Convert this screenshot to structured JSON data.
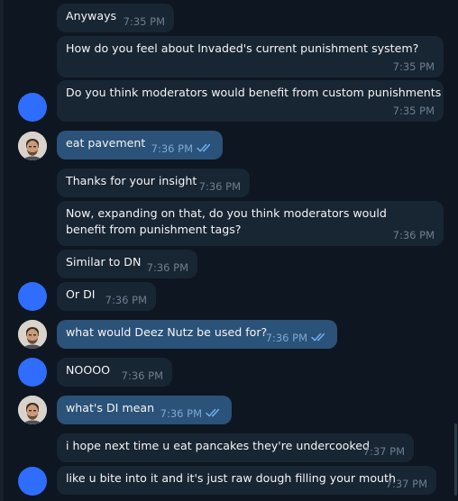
{
  "chat": {
    "messages": [
      {
        "id": "m1",
        "direction": "in",
        "text": "Anyways",
        "time": "7:35 PM"
      },
      {
        "id": "m2",
        "direction": "in",
        "text": "How do you feel about Invaded's current punishment system?",
        "time": "7:35 PM"
      },
      {
        "id": "m3",
        "direction": "in",
        "text": "Do you think moderators would benefit from custom punishments",
        "time": "7:35 PM"
      },
      {
        "id": "m4",
        "direction": "out",
        "text": "eat pavement",
        "time": "7:36 PM"
      },
      {
        "id": "m5",
        "direction": "in",
        "text": "Thanks for your insight",
        "time": "7:36 PM"
      },
      {
        "id": "m6",
        "direction": "in",
        "text": "Now, expanding on that, do you think moderators would benefit from punishment tags?",
        "time": "7:36 PM"
      },
      {
        "id": "m7",
        "direction": "in",
        "text": "Similar to DN",
        "time": "7:36 PM"
      },
      {
        "id": "m8",
        "direction": "in",
        "text": "Or DI",
        "time": "7:36 PM"
      },
      {
        "id": "m9",
        "direction": "out",
        "text": "what would Deez Nutz be used for?",
        "time": "7:36 PM"
      },
      {
        "id": "m10",
        "direction": "in",
        "text": "NOOOO",
        "time": "7:36 PM"
      },
      {
        "id": "m11",
        "direction": "out",
        "text": "what's DI mean",
        "time": "7:36 PM"
      },
      {
        "id": "m12",
        "direction": "in",
        "text": "i hope next time u eat pancakes they're undercooked",
        "time": "7:37 PM"
      },
      {
        "id": "m13",
        "direction": "in",
        "text": "like u bite into it and it's just raw dough filling your mouth",
        "time": "7:37 PM"
      }
    ]
  },
  "icons": {
    "read_receipt": "double-check-icon",
    "incoming_avatar": "blue-circle-avatar",
    "outgoing_avatar": "user-photo-avatar"
  },
  "colors": {
    "background": "#0e1621",
    "incoming_bubble": "#182533",
    "outgoing_bubble": "#2b5278",
    "incoming_avatar": "#2f6dff",
    "read_check": "#6cb0f2"
  }
}
